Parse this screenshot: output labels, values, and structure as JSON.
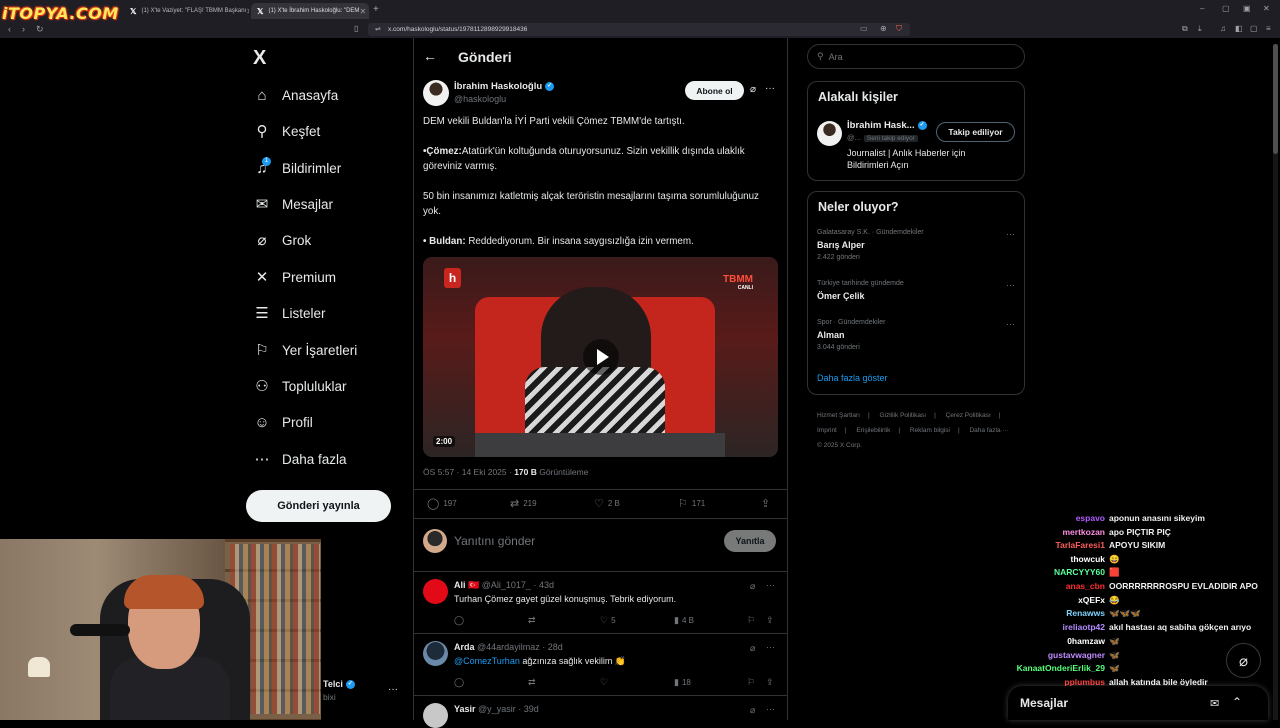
{
  "browser": {
    "site_logo": "iTOPYA.COM",
    "tabs": [
      {
        "label": "(1) X'te Vaziyet: \"FLAŞ! TBMM Başkanı",
        "icon": "x-icon"
      },
      {
        "label": "(1) X'te İbrahim Haskoloğlu: \"DEM",
        "icon": "x-icon"
      }
    ],
    "new_tab": "+",
    "url": "x.com/haskologlu/status/1978112898929918436"
  },
  "nav": {
    "logo": "X",
    "items": [
      {
        "label": "Anasayfa",
        "icon": "home-icon"
      },
      {
        "label": "Keşfet",
        "icon": "search-icon"
      },
      {
        "label": "Bildirimler",
        "icon": "bell-icon"
      },
      {
        "label": "Mesajlar",
        "icon": "mail-icon"
      },
      {
        "label": "Grok",
        "icon": "grok-icon"
      },
      {
        "label": "Premium",
        "icon": "x-icon"
      },
      {
        "label": "Listeler",
        "icon": "list-icon"
      },
      {
        "label": "Yer İşaretleri",
        "icon": "bookmark-icon"
      },
      {
        "label": "Topluluklar",
        "icon": "people-icon"
      },
      {
        "label": "Profil",
        "icon": "user-icon"
      },
      {
        "label": "Daha fazla",
        "icon": "more-circle-icon"
      }
    ],
    "notification_count": "1",
    "post_button": "Gönderi yayınla"
  },
  "account": {
    "name": "Telci",
    "handle": "bixi"
  },
  "post": {
    "header_title": "Gönderi",
    "author_name": "İbrahim Haskoloğlu",
    "author_handle": "@haskologlu",
    "subscribe_label": "Abone ol",
    "lines": {
      "l1": "DEM vekili Buldan'la İYİ Parti vekili Çömez TBMM'de tartıştı.",
      "l2_bold": "•Çömez:",
      "l2_rest": "Atatürk'ün koltuğunda oturuyorsunuz. Sizin vekillik dışında ulaklık göreviniz varmış.",
      "l3": "50 bin insanımızı katletmiş alçak teröristin mesajlarını taşıma sorumluluğunuz yok.",
      "l4_bold": "• Buldan:",
      "l4_rest": " Reddediyorum. Bir insana saygısızlığa izin vermem."
    },
    "video": {
      "duration": "2:00",
      "channel_logo": "h",
      "tbmm_label": "TBMM",
      "tbmm_sub": "CANLI"
    },
    "time": "ÖS 5:57 · 14 Eki 2025 · ",
    "views": "170 B",
    "views_label": " Görüntüleme",
    "actions": {
      "replies": "197",
      "reposts": "219",
      "likes": "2 B",
      "bookmarks": "171"
    },
    "reply_placeholder": "Yanıtını gönder",
    "reply_button": "Yanıtla"
  },
  "replies": [
    {
      "name": "Ali",
      "flag": "🇹🇷",
      "handle": "@Ali_1017_",
      "time": "· 43d",
      "text": "Turhan Çömez gayet güzel konuşmuş. Tebrik ediyorum.",
      "mention": "",
      "replies": "",
      "reposts": "",
      "likes": "5",
      "views": "4 B"
    },
    {
      "name": "Arda",
      "flag": "",
      "handle": "@44ardayilmaz",
      "time": "· 28d",
      "text": " ağzınıza sağlık vekilim 👏",
      "mention": "@ComezTurhan",
      "replies": "",
      "reposts": "",
      "likes": "",
      "views": "18"
    },
    {
      "name": "Yasir",
      "flag": "",
      "handle": "@y_yasir",
      "time": "· 39d",
      "text": "",
      "mention": "",
      "replies": "",
      "reposts": "",
      "likes": "",
      "views": ""
    }
  ],
  "sidebar": {
    "search_placeholder": "Ara",
    "related": {
      "title": "Alakalı kişiler",
      "name": "İbrahim Hask...",
      "handle": "@...",
      "follows_you": "Seni takip ediyor",
      "follow_button": "Takip ediliyor",
      "bio": "Journalist | Anlık Haberler için Bildirimleri Açın"
    },
    "trending": {
      "title": "Neler oluyor?",
      "items": [
        {
          "context": "Galatasaray S.K. · Gündemdekiler",
          "name": "Barış Alper",
          "count": "2.422 gönderi"
        },
        {
          "context": "Türkiye tarihinde gündemde",
          "name": "Ömer Çelik",
          "count": ""
        },
        {
          "context": "Spor · Gündemdekiler",
          "name": "Alman",
          "count": "3.044 gönderi"
        }
      ],
      "show_more": "Daha fazla göster"
    },
    "footer": [
      "Hizmet Şartları",
      "|",
      "Gizlilik Politikası",
      "|",
      "Çerez Politikası",
      "|",
      "Imprint",
      "|",
      "Erişilebilirlik",
      "|",
      "Reklam bilgisi",
      "|",
      "Daha fazla ···",
      "© 2025 X Corp."
    ]
  },
  "chat": [
    {
      "user": "espavo",
      "msg": "aponun anasını sikeyim",
      "color": "#b05cff"
    },
    {
      "user": "mertkozan",
      "msg": "apo PIÇTIR PIÇ",
      "color": "#ff8de0"
    },
    {
      "user": "TarlaFaresi1",
      "msg": "APOYU SIKIM",
      "color": "#ff5c5c"
    },
    {
      "user": "thowcuk",
      "msg": "😄",
      "color": "#ffffff"
    },
    {
      "user": "NARCYYY60",
      "msg": "🟥",
      "color": "#5bff9e"
    },
    {
      "user": "anas_cbn",
      "msg": "OORRRRRRROSPU EVLADIDIR APO",
      "color": "#ff2e2e"
    },
    {
      "user": "xQEFx",
      "msg": "😂",
      "color": "#ffffff"
    },
    {
      "user": "Renawws",
      "msg": "🦋🦋🦋",
      "color": "#7fd3ff"
    },
    {
      "user": "ireliaotp42",
      "msg": "akıl hastası aq sabiha gökçen arıyo",
      "color": "#b48cff"
    },
    {
      "user": "0hamzaw",
      "msg": "🦋",
      "color": "#ffffff"
    },
    {
      "user": "gustavwagner",
      "msg": "🦋",
      "color": "#c18bff"
    },
    {
      "user": "KanaatOnderiErlik_29",
      "msg": "🦋",
      "color": "#57ff7a"
    },
    {
      "user": "pplumbus",
      "msg": "allah katında bile öyledir",
      "color": "#ff3b3b"
    }
  ],
  "messages_drawer": {
    "title": "Mesajlar"
  },
  "colors": {
    "accent": "#1d9bf0",
    "background": "#000000",
    "border": "#2f3336",
    "muted": "#71767b"
  }
}
